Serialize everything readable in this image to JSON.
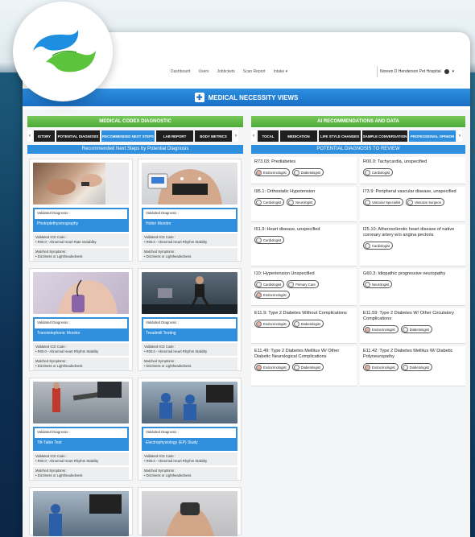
{
  "nav": {
    "items": [
      "Dashboard",
      "Users",
      "Jobtickets",
      "Scan Report",
      "Intake"
    ],
    "user_name": "Noreen D Henderson Pet Hospital"
  },
  "banner": {
    "title": "MEDICAL NECESSITY VIEWS"
  },
  "left": {
    "header": "MEDICAL CODEX DIAGNOSTIC",
    "tabs": [
      "ISTORY",
      "POTENTIAL DIAGNOSIS",
      "RECOMMENDED NEXT STEPS",
      "LAB REPORT",
      "BODY METRICS"
    ],
    "subheader": "Recommended Next Steps by Potential Diagnosis",
    "cards": [
      {
        "label": "Validated Diagnosis :",
        "name": "Photoplethysmography",
        "icd_label": "Validated ICD Code :",
        "icd": "R00.0 - Abnormal Heart Rate Variability",
        "ms_label": "Matched Symptoms :",
        "ms": "Dizziness or Lightheadedness"
      },
      {
        "label": "Validated Diagnosis :",
        "name": "Holter Monitor",
        "icd_label": "Validated ICD Code :",
        "icd": "R00.0 - Abnormal Heart Rhythm Stability",
        "ms_label": "Matched Symptoms :",
        "ms": "Dizziness or Lightheadedness"
      },
      {
        "label": "Validated Diagnosis :",
        "name": "Transtelephonic Monitor",
        "icd_label": "Validated ICD Code :",
        "icd": "R00.0 - Abnormal Heart Rhythm Stability",
        "ms_label": "Matched Symptoms :",
        "ms": "Dizziness or Lightheadedness"
      },
      {
        "label": "Validated Diagnosis :",
        "name": "Treadmill Testing",
        "icd_label": "Validated ICD Code :",
        "icd": "R00.0 - Abnormal Heart Rhythm Stability",
        "ms_label": "Matched Symptoms :",
        "ms": "Dizziness or Lightheadedness"
      },
      {
        "label": "Validated Diagnosis :",
        "name": "Tilt-Table Test",
        "icd_label": "Validated ICD Code :",
        "icd": "R00.0 - Abnormal Heart Rhythm Stability",
        "ms_label": "Matched Symptoms :",
        "ms": "Dizziness or Lightheadedness"
      },
      {
        "label": "Validated Diagnosis :",
        "name": "Electrophysiology (EP) Study",
        "icd_label": "Validated ICD Code :",
        "icd": "R00.0 - Abnormal Heart Rhythm Stability",
        "ms_label": "Matched Symptoms :",
        "ms": "Dizziness or Lightheadedness"
      }
    ]
  },
  "right": {
    "header": "AI RECOMMENDATIONS AND DATA",
    "tabs": [
      "TOCAL",
      "MEDICATION",
      "LIFE STYLE CHANGES",
      "SAMPLE CONVERSATION",
      "PROFESSIONAL OPINION"
    ],
    "subheader": "POTENTIAL DIAGNOSIS TO REVIEW",
    "diagnoses": [
      {
        "title": "R73.03: Prediabetes",
        "chips": [
          "Endocrinologist",
          "Diabetologist"
        ]
      },
      {
        "title": "R00.0: Tachycardia, unspecified",
        "chips": [
          "Cardiologist"
        ]
      },
      {
        "title": "I95.1: Orthostatic Hypotension",
        "chips": [
          "Cardiologist",
          "Neurologist"
        ]
      },
      {
        "title": "I73.9: Peripheral vascular disease, unspecified",
        "chips": [
          "Vascular Specialist",
          "Vascular Surgeon"
        ]
      },
      {
        "title": "I51.9: Heart disease, unspecified",
        "chips": [
          "Cardiologist"
        ]
      },
      {
        "title": "I25.10: Atherosclerotic heart disease of native coronary artery w/o angina pectoris",
        "chips": [
          "Cardiologist"
        ]
      },
      {
        "title": "I10: Hypertension Unspecified",
        "chips": [
          "Cardiologist",
          "Primary Care",
          "Endocrinologist"
        ]
      },
      {
        "title": "G60.3: Idiopathic progressive neuropathy",
        "chips": [
          "Neurologist"
        ]
      },
      {
        "title": "E11.9: Type 2 Diabetes Without Complications",
        "chips": [
          "Endocrinologist",
          "Diabetologist"
        ]
      },
      {
        "title": "E11.59: Type 2 Diabetes W/ Other Circulatory Complications",
        "chips": [
          "Endocrinologist",
          "Diabetologist"
        ]
      },
      {
        "title": "E11.49: Type 2 Diabetes Mellitus W/ Other Diabetic Neurological Complications",
        "chips": [
          "Endocrinologist",
          "Diabetologist"
        ]
      },
      {
        "title": "E11.42: Type 2 Diabetes Mellitus W/ Diabetic Polyneuropathy",
        "chips": [
          "Endocrinologist",
          "Diabetologist"
        ]
      }
    ]
  }
}
